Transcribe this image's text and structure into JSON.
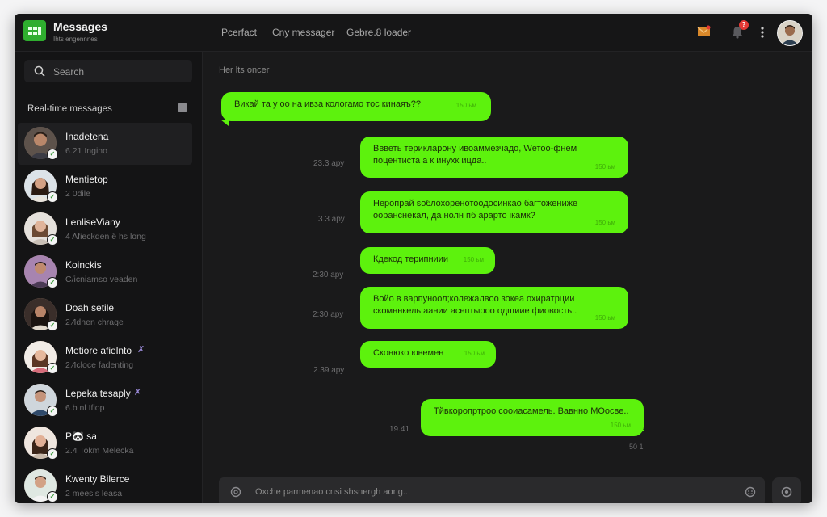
{
  "app": {
    "title": "Messages",
    "subtitle": "Ihts engennnes"
  },
  "header": {
    "tabs": [
      "Pcerfact",
      "Cny messager",
      "Gebre.8 loader"
    ],
    "notification_count": "?"
  },
  "sidebar": {
    "search_placeholder": "Search",
    "section_title": "Real-time messages",
    "contacts": [
      {
        "name": "Inadetena",
        "preview": "6.21 Ingino"
      },
      {
        "name": "Mentietop",
        "preview": "2 0dile"
      },
      {
        "name": "LenliseViany",
        "preview": "4 Afieckden ë hs long"
      },
      {
        "name": "Koinckis",
        "preview": "C/icniamso veaden"
      },
      {
        "name": "Doah setile",
        "preview": "2 ⁄Idnen chrage"
      },
      {
        "name": "Metiore afielnto",
        "preview": "2 ⁄Icloce fadenting"
      },
      {
        "name": "Lepeka tesaply",
        "preview": "6.b nl Ifiop"
      },
      {
        "name": "P🐼 sa",
        "preview": "2.4 Tokm Melecka"
      },
      {
        "name": "Kwenty Bilerce",
        "preview": "2 meesis leasa"
      }
    ]
  },
  "chat": {
    "day_label": "Her lts oncer",
    "messages": [
      {
        "text": "Викай та у оо на ивза кологамо тос кинаяъ??",
        "meta": "150 ьм",
        "side": "left",
        "time": ""
      },
      {
        "text": "Ввветь терикларону ивоаммезчадо, Wетоо-фнем поцентиста а к инухк ицда..",
        "meta": "150 ьм",
        "side": "right",
        "time": "23.3 ару"
      },
      {
        "text": "Неропрай ѕоблохоренотоодосинкао багтожениже ооранснекал, да нолн пб арарто ікамк?",
        "meta": "150 ьм",
        "side": "right",
        "time": "3.3 ару"
      },
      {
        "text": "Кдекод терипниии",
        "meta": "150 ьм",
        "side": "right",
        "time": "2:30 ару"
      },
      {
        "text": "Войо в варпуноол;колежалвоо зокеа охиратрции скомннкель аании асептыооо одщиие фиовость..",
        "meta": "150 ьм",
        "side": "right",
        "time": "2:30 ару"
      },
      {
        "text": "Сконюко ювемен",
        "meta": "150 ьм",
        "side": "right",
        "time": "2.39 ару"
      },
      {
        "text": "Тйвкоропртроо сооиасамель. Вавнно МОосве..",
        "meta": "150 ьм",
        "side": "right",
        "time": "19.41"
      }
    ],
    "footer_time": "50 1"
  },
  "composer": {
    "placeholder": "Oxche parmenao cnsi shsnergh aong..."
  }
}
